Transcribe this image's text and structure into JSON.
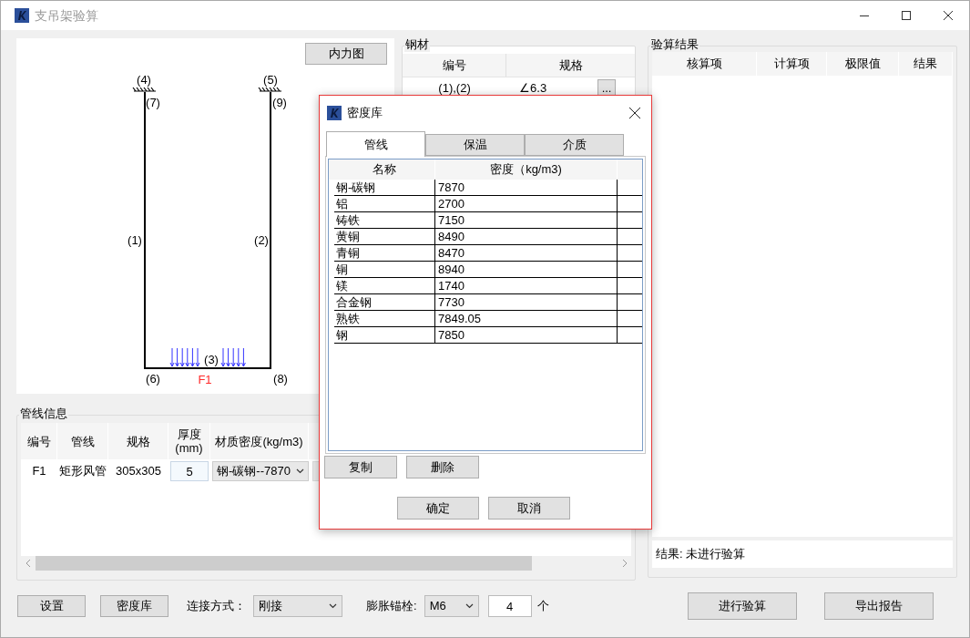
{
  "window": {
    "title": "支吊架验算"
  },
  "diagram": {
    "button": "内力图",
    "labels": [
      "(4)",
      "(5)",
      "(7)",
      "(9)",
      "(1)",
      "(2)",
      "(6)",
      "(3)",
      "(8)"
    ],
    "load_label": "F1"
  },
  "steel": {
    "title": "钢材",
    "columns": [
      "编号",
      "规格"
    ],
    "rows": [
      {
        "id": "(1),(2)",
        "spec": "∠6.3",
        "button": "..."
      }
    ]
  },
  "results": {
    "title": "验算结果",
    "columns": [
      "核算项",
      "计算项",
      "极限值",
      "结果"
    ],
    "summary": "结果: 未进行验算"
  },
  "pipes": {
    "title": "管线信息",
    "columns": [
      "编号",
      "管线",
      "规格",
      "厚度 (mm)",
      "材质密度(kg/m3)"
    ],
    "rows": [
      {
        "id": "F1",
        "type": "矩形风管",
        "spec": "305x305",
        "thickness": "5",
        "material": "钢-碳钢--7870"
      }
    ]
  },
  "bottom": {
    "buttons": [
      "设置",
      "密度库"
    ],
    "connection_label": "连接方式：",
    "connection_value": "刚接",
    "anchor_label": "膨胀锚栓:",
    "anchor_value": "M6",
    "count": "4",
    "unit": "个",
    "actions": [
      "进行验算",
      "导出报告"
    ]
  },
  "dialog": {
    "title": "密度库",
    "tabs": [
      {
        "label": "管线",
        "selected": true
      },
      {
        "label": "保温",
        "selected": false
      },
      {
        "label": "介质",
        "selected": false
      }
    ],
    "columns": [
      "名称",
      "密度（kg/m3)"
    ],
    "rows": [
      {
        "name": "钢-碳钢",
        "density": "7870"
      },
      {
        "name": "铝",
        "density": "2700"
      },
      {
        "name": "铸铁",
        "density": "7150"
      },
      {
        "name": "黄铜",
        "density": "8490"
      },
      {
        "name": "青铜",
        "density": "8470"
      },
      {
        "name": "铜",
        "density": "8940"
      },
      {
        "name": "镁",
        "density": "1740"
      },
      {
        "name": "合金钢",
        "density": "7730"
      },
      {
        "name": "熟铁",
        "density": "7849.05"
      },
      {
        "name": "钢",
        "density": "7850"
      }
    ],
    "edit_buttons": [
      "复制",
      "删除"
    ],
    "buttons": [
      "确定",
      "取消"
    ]
  }
}
